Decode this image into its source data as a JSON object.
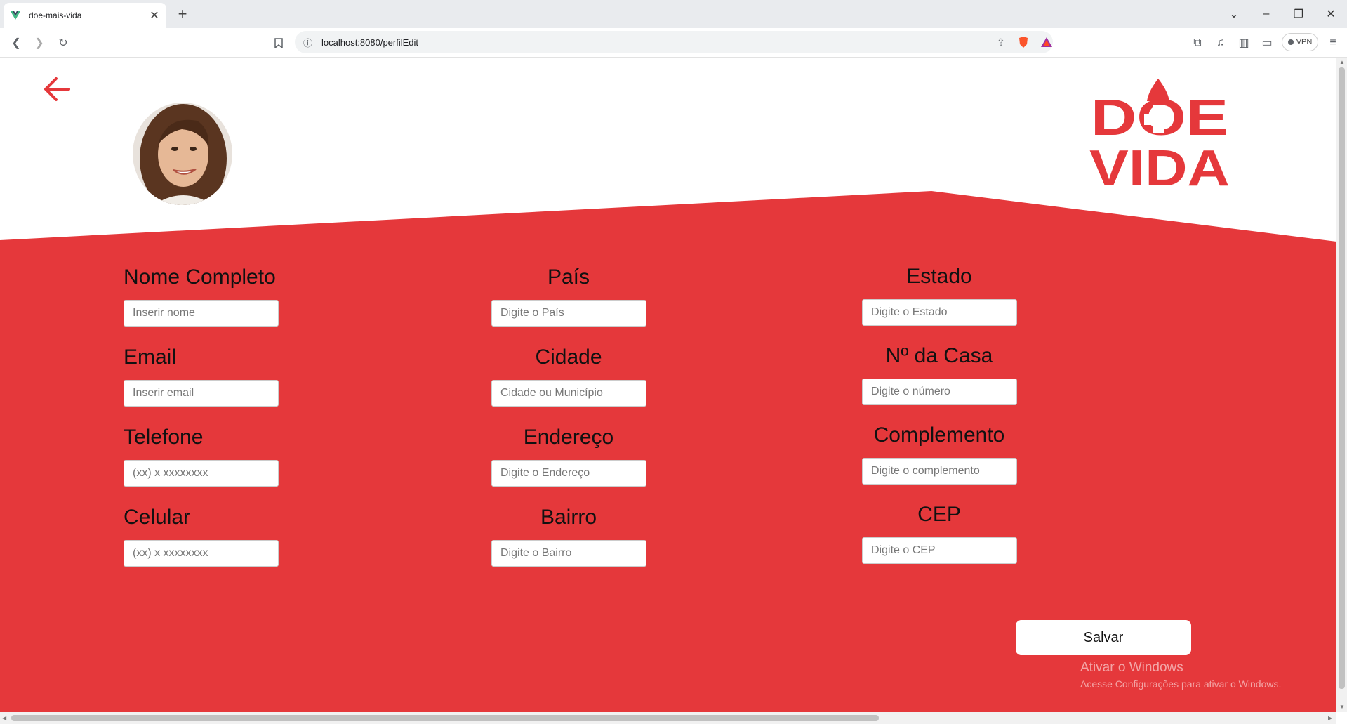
{
  "browser": {
    "tab_title": "doe-mais-vida",
    "new_tab": "+",
    "url": "localhost:8080/perfilEdit",
    "vpn_label": "VPN"
  },
  "page": {
    "logo_line1": "DOE",
    "logo_line2": "VIDA",
    "save_label": "Salvar",
    "colors": {
      "brand_red": "#e5383b",
      "white": "#ffffff"
    },
    "fields": {
      "nome": {
        "label": "Nome Completo",
        "placeholder": "Inserir nome"
      },
      "email": {
        "label": "Email",
        "placeholder": "Inserir email"
      },
      "telefone": {
        "label": "Telefone",
        "placeholder": "(xx) x xxxxxxxx"
      },
      "celular": {
        "label": "Celular",
        "placeholder": "(xx) x xxxxxxxx"
      },
      "pais": {
        "label": "País",
        "placeholder": "Digite o País"
      },
      "cidade": {
        "label": "Cidade",
        "placeholder": "Cidade ou Município"
      },
      "endereco": {
        "label": "Endereço",
        "placeholder": "Digite o Endereço"
      },
      "bairro": {
        "label": "Bairro",
        "placeholder": "Digite o Bairro"
      },
      "estado": {
        "label": "Estado",
        "placeholder": "Digite o Estado"
      },
      "numero": {
        "label": "Nº da Casa",
        "placeholder": "Digite o número"
      },
      "complemento": {
        "label": "Complemento",
        "placeholder": "Digite o complemento"
      },
      "cep": {
        "label": "CEP",
        "placeholder": "Digite o CEP"
      }
    }
  },
  "os_watermark": {
    "line1": "Ativar o Windows",
    "line2": "Acesse Configurações para ativar o Windows."
  }
}
